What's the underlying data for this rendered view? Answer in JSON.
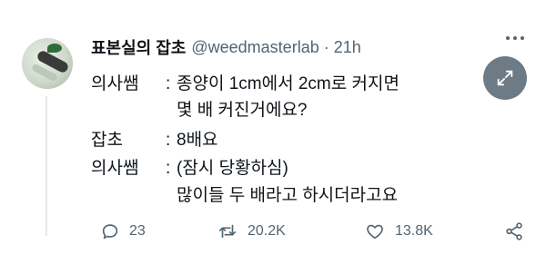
{
  "tweet": {
    "author_name": "표본실의 잡초",
    "handle": "@weedmasterlab",
    "separator": "·",
    "time": "21h",
    "lines": [
      {
        "speaker": "의사쌤",
        "sep": ":",
        "text": "종양이 1cm에서 2cm로 커지면"
      },
      {
        "speaker": "",
        "sep": "",
        "text": "몇 배 커진거에요?"
      },
      {
        "speaker": "잡초",
        "sep": ":",
        "text": "8배요"
      },
      {
        "speaker": "의사쌤",
        "sep": ":",
        "text": "(잠시 당황하심)"
      },
      {
        "speaker": "",
        "sep": "",
        "text": "많이들 두 배라고 하시더라고요"
      }
    ],
    "actions": {
      "reply_count": "23",
      "retweet_count": "20.2K",
      "like_count": "13.8K"
    }
  },
  "icons": {
    "more": "more-horizontal-icon",
    "expand": "expand-icon",
    "reply": "reply-icon",
    "retweet": "retweet-icon",
    "like": "heart-icon",
    "share": "share-icon"
  },
  "colors": {
    "text": "#0f1419",
    "muted": "#536471",
    "expand_bg": "#536471"
  }
}
